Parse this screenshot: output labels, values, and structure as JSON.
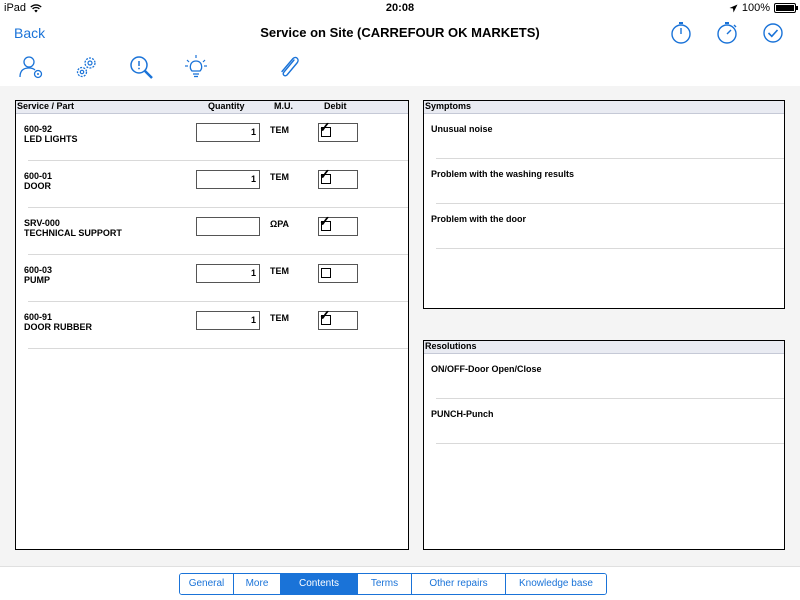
{
  "statusbar": {
    "device": "iPad",
    "time": "20:08",
    "battery": "100%",
    "battery_level": 1.0
  },
  "navbar": {
    "back_label": "Back",
    "title": "Service on Site (CARREFOUR OK MARKETS)"
  },
  "icons": {
    "nav": [
      "stopwatch-icon",
      "timer-icon",
      "checkmark-circle-icon"
    ],
    "toolbar": [
      "customer-settings-icon",
      "gears-icon",
      "search-zoom-icon",
      "lightbulb-icon",
      "paperclip-icon"
    ]
  },
  "colors": {
    "accent": "#1a73d8",
    "header_bg": "#e9ebf2",
    "gray_area": "#f4f4f4"
  },
  "parts": {
    "headers": {
      "service": "Service / Part",
      "quantity": "Quantity",
      "mu": "M.U.",
      "debit": "Debit"
    },
    "rows": [
      {
        "code": "600-92",
        "name": "LED LIGHTS",
        "quantity": "1",
        "mu": "TEM",
        "debit": true
      },
      {
        "code": "600-01",
        "name": "DOOR",
        "quantity": "1",
        "mu": "TEM",
        "debit": true
      },
      {
        "code": "SRV-000",
        "name": "TECHNICAL SUPPORT",
        "quantity": "",
        "mu": "ΩΡΑ",
        "debit": true
      },
      {
        "code": "600-03",
        "name": "PUMP",
        "quantity": "1",
        "mu": "TEM",
        "debit": false
      },
      {
        "code": "600-91",
        "name": "DOOR RUBBER",
        "quantity": "1",
        "mu": "TEM",
        "debit": true
      }
    ]
  },
  "symptoms": {
    "header": "Symptoms",
    "items": [
      "Unusual noise",
      "Problem with the washing results",
      "Problem with the door"
    ]
  },
  "resolutions": {
    "header": "Resolutions",
    "items": [
      "ON/OFF-Door Open/Close",
      "PUNCH-Punch"
    ]
  },
  "tabs": {
    "items": [
      "General",
      "More",
      "Contents",
      "Terms",
      "Other repairs",
      "Knowledge base"
    ],
    "active": "Contents"
  }
}
